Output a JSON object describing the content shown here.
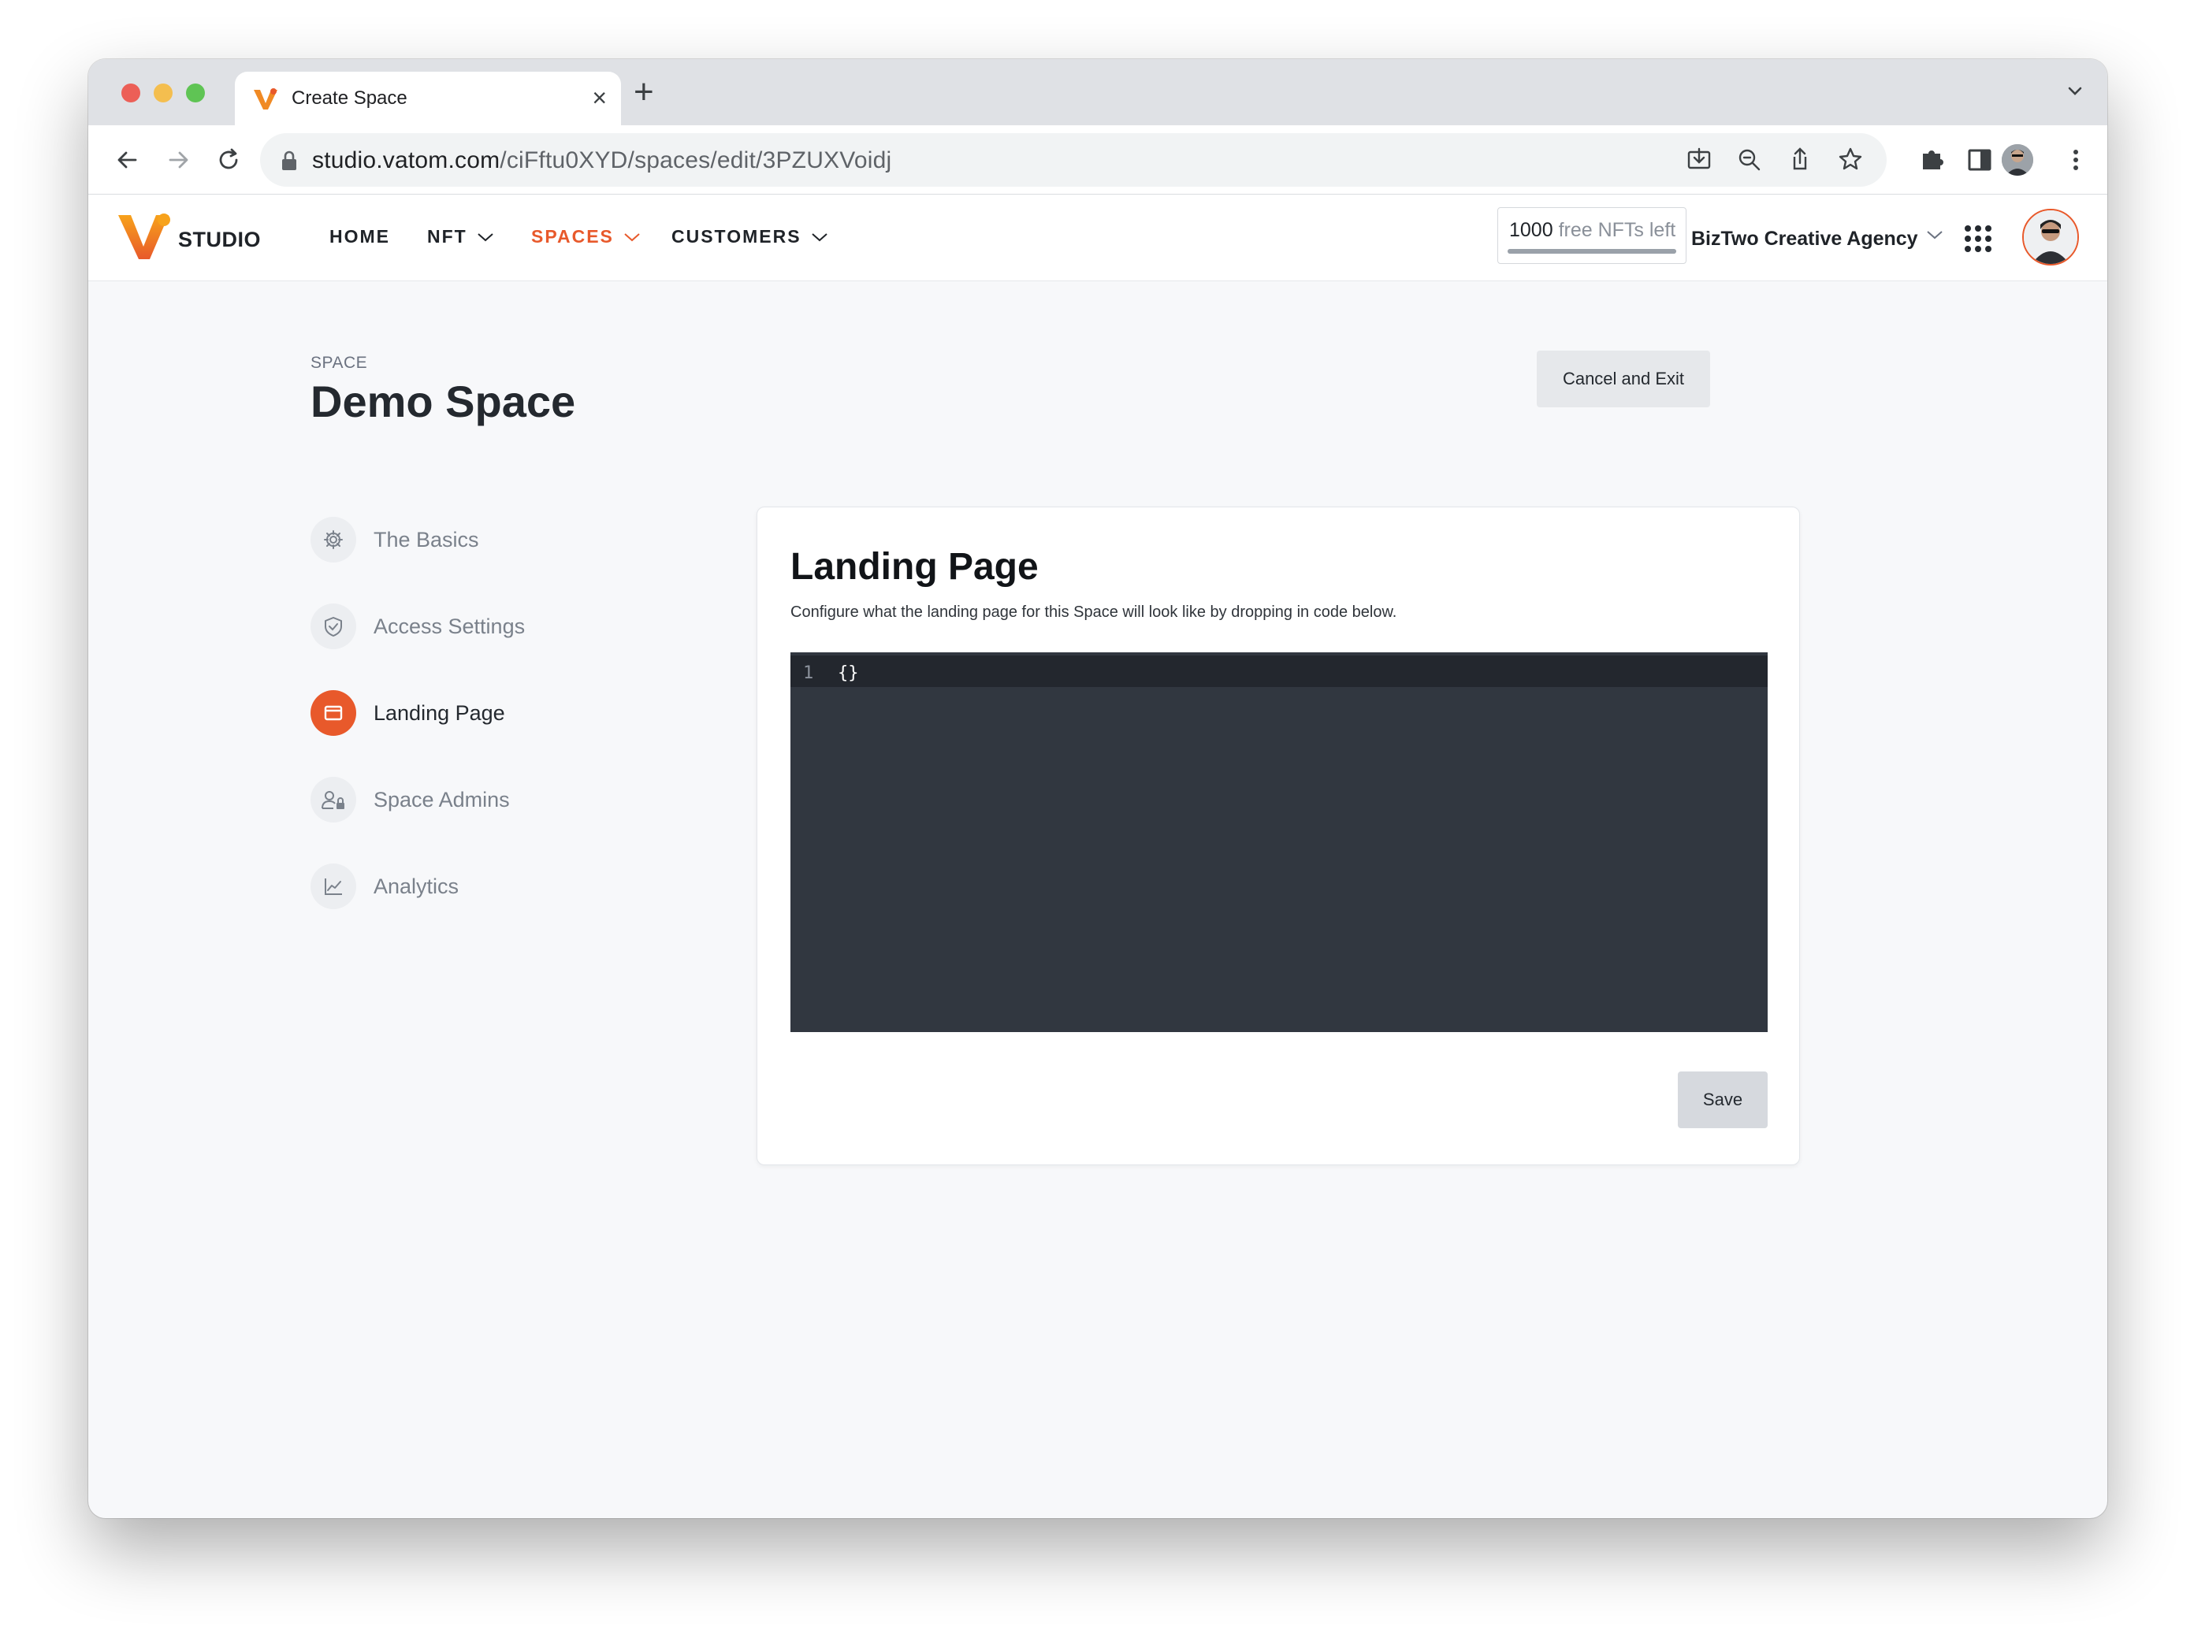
{
  "browser": {
    "tab_title": "Create Space",
    "url_host": "studio.vatom.com",
    "url_path": "/ciFftu0XYD/spaces/edit/3PZUXVoidj"
  },
  "header": {
    "logo_text": "STUDIO",
    "nav": [
      {
        "label": "HOME"
      },
      {
        "label": "NFT"
      },
      {
        "label": "SPACES"
      },
      {
        "label": "CUSTOMERS"
      }
    ],
    "nft_counter": {
      "count": "1000",
      "label": "free NFTs left",
      "fill_fraction": 1.0
    },
    "org_name": "BizTwo Creative Agency"
  },
  "page": {
    "eyebrow": "SPACE",
    "title": "Demo Space",
    "cancel_label": "Cancel and Exit"
  },
  "steps": [
    {
      "label": "The Basics",
      "icon": "gear-icon"
    },
    {
      "label": "Access Settings",
      "icon": "shield-check-icon"
    },
    {
      "label": "Landing Page",
      "icon": "browser-window-icon",
      "active": true
    },
    {
      "label": "Space Admins",
      "icon": "user-lock-icon"
    },
    {
      "label": "Analytics",
      "icon": "line-chart-icon"
    }
  ],
  "card": {
    "title": "Landing Page",
    "description": "Configure what the landing page for this Space will look like by dropping in code below.",
    "editor": {
      "line_number": "1",
      "code": "{}"
    },
    "save_label": "Save"
  },
  "colors": {
    "accent": "#e8592b",
    "editor_bg": "#313740",
    "editor_active_line": "#23272e"
  }
}
